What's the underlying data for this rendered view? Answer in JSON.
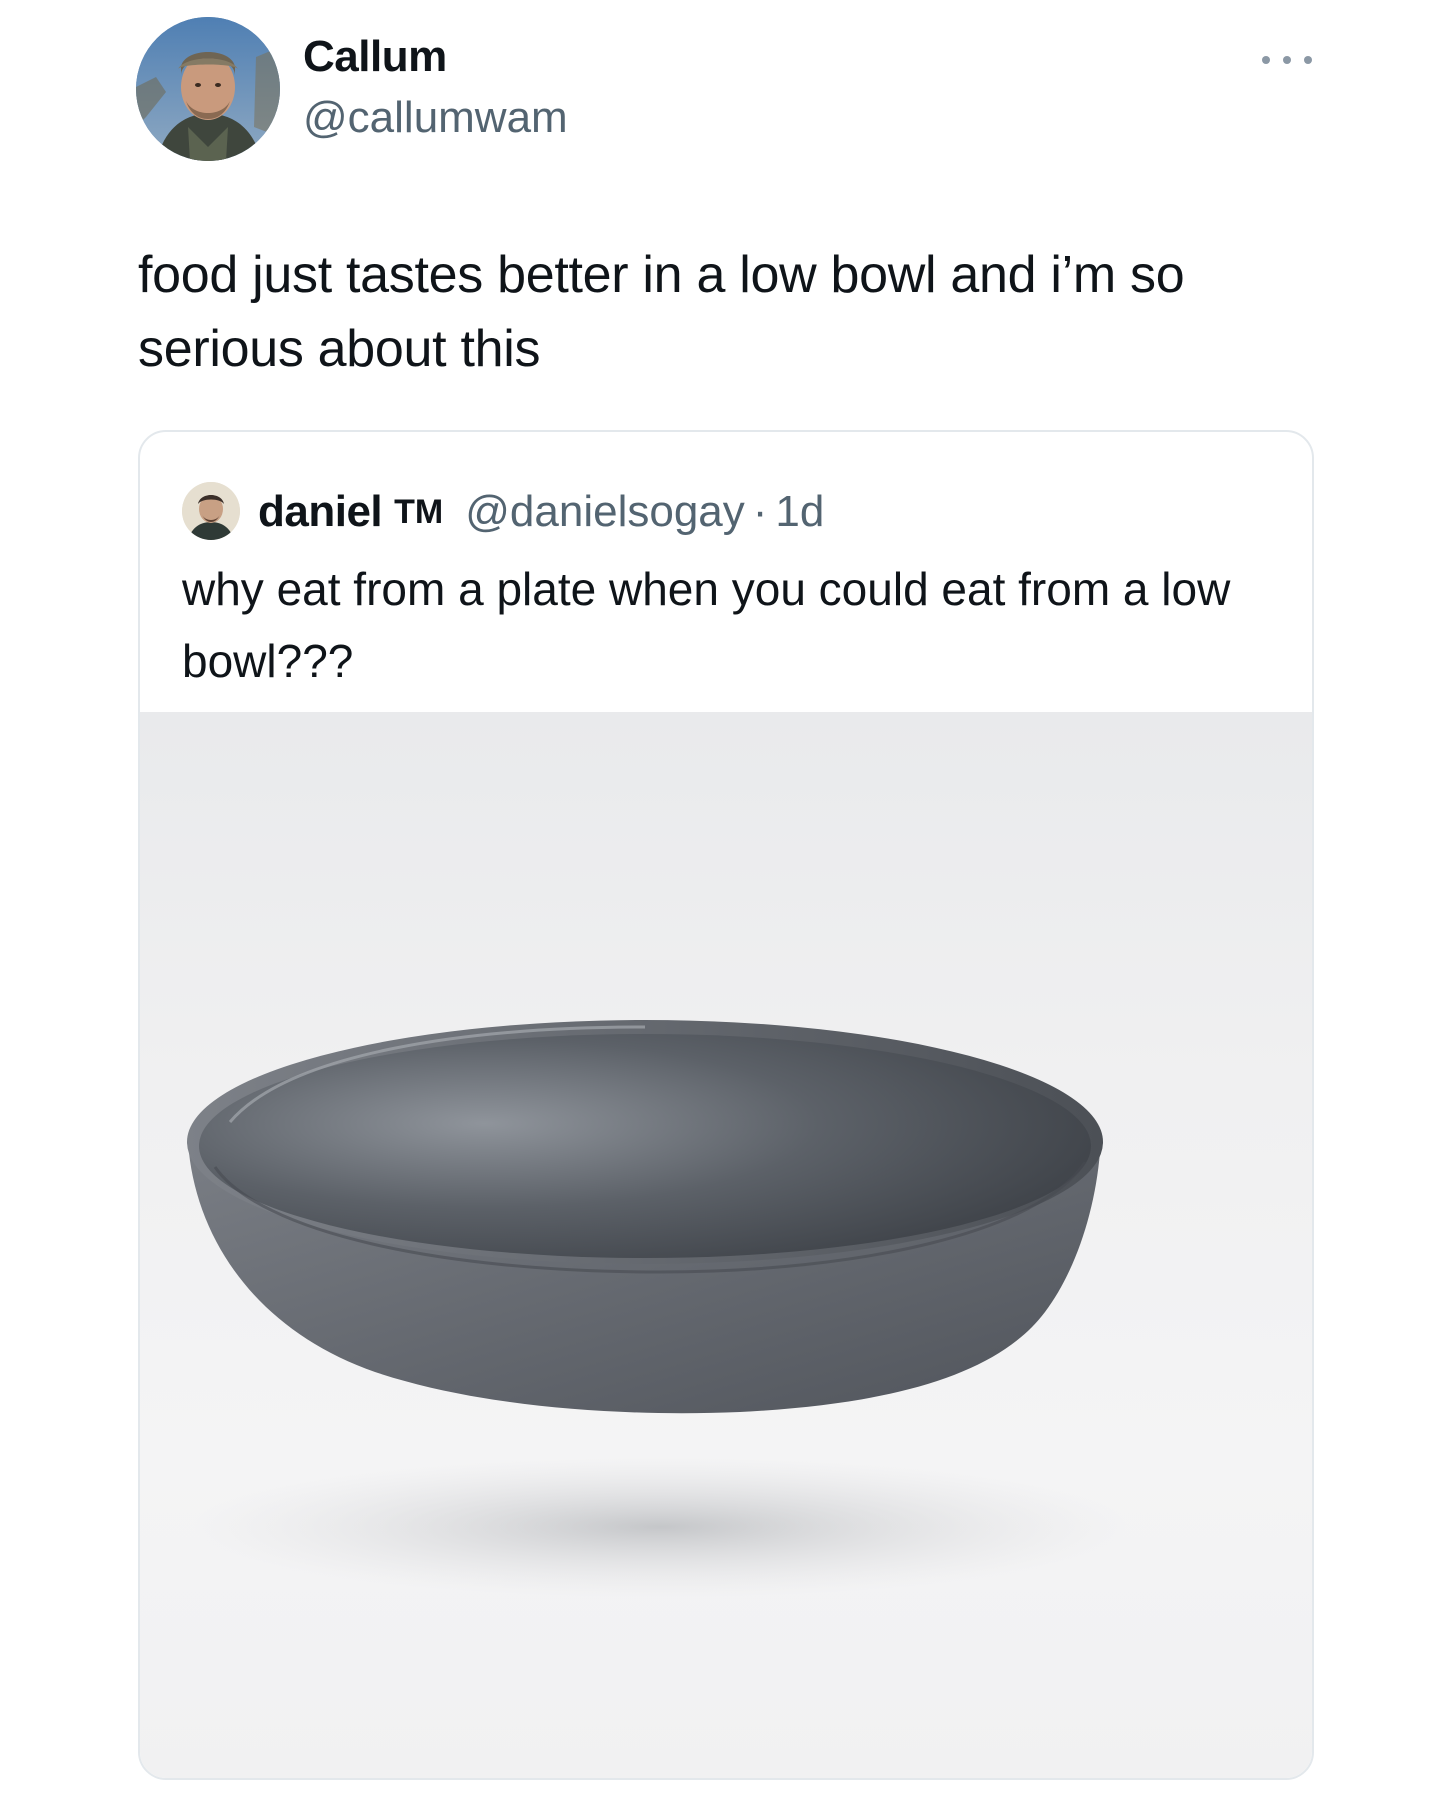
{
  "tweet": {
    "author": {
      "name": "Callum",
      "handle": "@callumwam"
    },
    "text": "food just tastes better in a low bowl and i’m so serious about this",
    "more_icon": "more-horizontal-icon"
  },
  "quoted_tweet": {
    "author": {
      "name": "daniel",
      "badge": "TM",
      "handle": "@danielsogay",
      "separator": "·",
      "time": "1d"
    },
    "text": "why eat from a plate when you could eat from a low bowl???",
    "media": {
      "subject": "low-bowl-image",
      "bowl_color": "#5f636a",
      "background_color": "#efeff0"
    }
  }
}
